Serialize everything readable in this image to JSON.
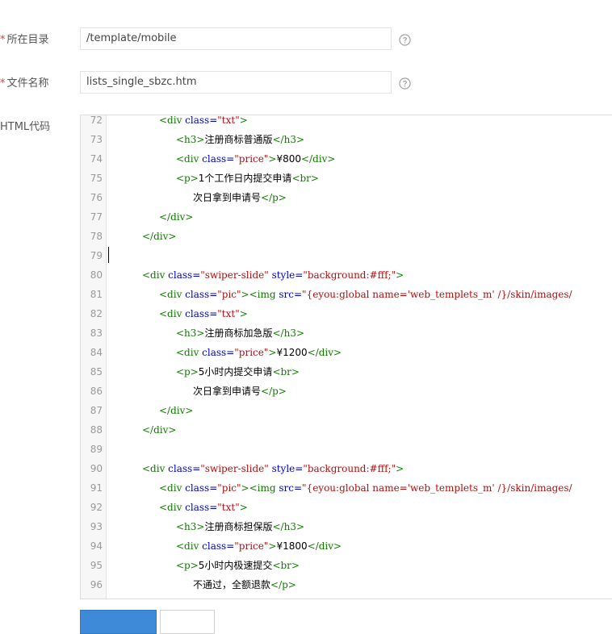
{
  "form": {
    "directory": {
      "required_mark": "*",
      "label": "所在目录",
      "value": "/template/mobile"
    },
    "filename": {
      "required_mark": "*",
      "label": "文件名称",
      "value": "lists_single_sbzc.htm"
    },
    "code_label": "HTML代码"
  },
  "editor": {
    "lines": [
      {
        "num": "72",
        "indent": 3,
        "parts": [
          [
            "t",
            "<div "
          ],
          [
            "a",
            "class="
          ],
          [
            "s",
            "\"txt\""
          ],
          [
            "t",
            ">"
          ]
        ]
      },
      {
        "num": "73",
        "indent": 4,
        "parts": [
          [
            "t",
            "<h3>"
          ],
          [
            "x",
            "注册商标普通版"
          ],
          [
            "t",
            "</h3>"
          ]
        ]
      },
      {
        "num": "74",
        "indent": 4,
        "parts": [
          [
            "t",
            "<div "
          ],
          [
            "a",
            "class="
          ],
          [
            "s",
            "\"price\""
          ],
          [
            "t",
            ">"
          ],
          [
            "x",
            "¥800"
          ],
          [
            "t",
            "</div>"
          ]
        ]
      },
      {
        "num": "75",
        "indent": 4,
        "parts": [
          [
            "t",
            "<p>"
          ],
          [
            "x",
            "1个工作日内提交申请"
          ],
          [
            "t",
            "<br>"
          ]
        ]
      },
      {
        "num": "76",
        "indent": 5,
        "parts": [
          [
            "x",
            "次日拿到申请号"
          ],
          [
            "t",
            "</p>"
          ]
        ]
      },
      {
        "num": "77",
        "indent": 3,
        "parts": [
          [
            "t",
            "</div>"
          ]
        ]
      },
      {
        "num": "78",
        "indent": 2,
        "parts": [
          [
            "t",
            "</div>"
          ]
        ]
      },
      {
        "num": "79",
        "indent": 0,
        "parts": []
      },
      {
        "num": "80",
        "indent": 2,
        "parts": [
          [
            "t",
            "<div "
          ],
          [
            "a",
            "class="
          ],
          [
            "s",
            "\"swiper-slide\""
          ],
          [
            "a",
            " style="
          ],
          [
            "s",
            "\"background:#fff;\""
          ],
          [
            "t",
            ">"
          ]
        ]
      },
      {
        "num": "81",
        "indent": 3,
        "parts": [
          [
            "t",
            "<div "
          ],
          [
            "a",
            "class="
          ],
          [
            "s",
            "\"pic\""
          ],
          [
            "t",
            "><img "
          ],
          [
            "a",
            "src="
          ],
          [
            "s",
            "\"{eyou:global name='web_templets_m' /}/skin/images/"
          ]
        ]
      },
      {
        "num": "82",
        "indent": 3,
        "parts": [
          [
            "t",
            "<div "
          ],
          [
            "a",
            "class="
          ],
          [
            "s",
            "\"txt\""
          ],
          [
            "t",
            ">"
          ]
        ]
      },
      {
        "num": "83",
        "indent": 4,
        "parts": [
          [
            "t",
            "<h3>"
          ],
          [
            "x",
            "注册商标加急版"
          ],
          [
            "t",
            "</h3>"
          ]
        ]
      },
      {
        "num": "84",
        "indent": 4,
        "parts": [
          [
            "t",
            "<div "
          ],
          [
            "a",
            "class="
          ],
          [
            "s",
            "\"price\""
          ],
          [
            "t",
            ">"
          ],
          [
            "x",
            "¥1200"
          ],
          [
            "t",
            "</div>"
          ]
        ]
      },
      {
        "num": "85",
        "indent": 4,
        "parts": [
          [
            "t",
            "<p>"
          ],
          [
            "x",
            "5小时内提交申请"
          ],
          [
            "t",
            "<br>"
          ]
        ]
      },
      {
        "num": "86",
        "indent": 5,
        "parts": [
          [
            "x",
            "次日拿到申请号"
          ],
          [
            "t",
            "</p>"
          ]
        ]
      },
      {
        "num": "87",
        "indent": 3,
        "parts": [
          [
            "t",
            "</div>"
          ]
        ]
      },
      {
        "num": "88",
        "indent": 2,
        "parts": [
          [
            "t",
            "</div>"
          ]
        ]
      },
      {
        "num": "89",
        "indent": 0,
        "parts": []
      },
      {
        "num": "90",
        "indent": 2,
        "parts": [
          [
            "t",
            "<div "
          ],
          [
            "a",
            "class="
          ],
          [
            "s",
            "\"swiper-slide\""
          ],
          [
            "a",
            " style="
          ],
          [
            "s",
            "\"background:#fff;\""
          ],
          [
            "t",
            ">"
          ]
        ]
      },
      {
        "num": "91",
        "indent": 3,
        "parts": [
          [
            "t",
            "<div "
          ],
          [
            "a",
            "class="
          ],
          [
            "s",
            "\"pic\""
          ],
          [
            "t",
            "><img "
          ],
          [
            "a",
            "src="
          ],
          [
            "s",
            "\"{eyou:global name='web_templets_m' /}/skin/images/"
          ]
        ]
      },
      {
        "num": "92",
        "indent": 3,
        "parts": [
          [
            "t",
            "<div "
          ],
          [
            "a",
            "class="
          ],
          [
            "s",
            "\"txt\""
          ],
          [
            "t",
            ">"
          ]
        ]
      },
      {
        "num": "93",
        "indent": 4,
        "parts": [
          [
            "t",
            "<h3>"
          ],
          [
            "x",
            "注册商标担保版"
          ],
          [
            "t",
            "</h3>"
          ]
        ]
      },
      {
        "num": "94",
        "indent": 4,
        "parts": [
          [
            "t",
            "<div "
          ],
          [
            "a",
            "class="
          ],
          [
            "s",
            "\"price\""
          ],
          [
            "t",
            ">"
          ],
          [
            "x",
            "¥1800"
          ],
          [
            "t",
            "</div>"
          ]
        ]
      },
      {
        "num": "95",
        "indent": 4,
        "parts": [
          [
            "t",
            "<p>"
          ],
          [
            "x",
            "5小时内极速提交"
          ],
          [
            "t",
            "<br>"
          ]
        ]
      },
      {
        "num": "96",
        "indent": 5,
        "parts": [
          [
            "x",
            "不通过，全额退款"
          ],
          [
            "t",
            "</p>"
          ]
        ]
      }
    ]
  }
}
